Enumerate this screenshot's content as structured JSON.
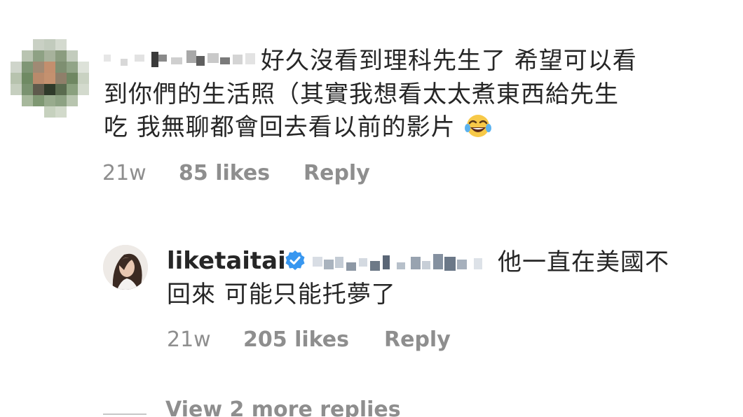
{
  "comment": {
    "line1": "好久沒看到理科先生了 希望可以看",
    "line2": "到你們的生活照（其實我想看太太煮東西給先生",
    "line3": "吃 我無聊都會回去看以前的影片",
    "emoji": "laughing-tears-emoji",
    "time": "21w",
    "likes": "85 likes",
    "reply_label": "Reply"
  },
  "reply": {
    "username": "liketaitai",
    "verified_icon": "verified-badge-icon",
    "line1": "他一直在美國不",
    "line2": "回來 可能只能托夢了",
    "time": "21w",
    "likes": "205 likes",
    "reply_label": "Reply"
  },
  "thread": {
    "view_more": "View 2 more replies"
  },
  "colors": {
    "text": "#262626",
    "meta": "#8e8e8e",
    "verified": "#3897f0"
  }
}
